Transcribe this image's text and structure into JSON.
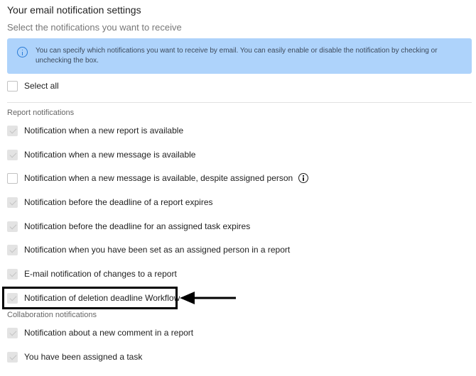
{
  "header": {
    "title": "Your email notification settings",
    "subtitle": "Select the notifications you want to receive"
  },
  "info": {
    "icon": "info-icon",
    "text": "You can specify which notifications you want to receive by email. You can easily enable or disable the notification by checking or unchecking the box."
  },
  "select_all": {
    "label": "Select all",
    "checked": false
  },
  "report_section": {
    "title": "Report notifications",
    "items": [
      {
        "label": "Notification when a new report is available",
        "checked": true
      },
      {
        "label": "Notification when a new message is available",
        "checked": true
      },
      {
        "label": "Notification when a new message is available, despite assigned person",
        "checked": false,
        "icon": "info-icon"
      },
      {
        "label": "Notification before the deadline of a report expires",
        "checked": true
      },
      {
        "label": "Notification before the deadline for an assigned task expires",
        "checked": true
      },
      {
        "label": "Notification when you have been set as an assigned person in a report",
        "checked": true
      },
      {
        "label": "E-mail notification of changes to a report",
        "checked": true
      },
      {
        "label": "Notification of deletion deadline Workflow",
        "checked": true
      }
    ]
  },
  "collaboration_section": {
    "title": "Collaboration notifications",
    "items": [
      {
        "label": "Notification about a new comment in a report",
        "checked": true
      },
      {
        "label": "You have been assigned a task",
        "checked": true
      }
    ]
  },
  "annotation": {
    "highlight": "box",
    "pointer": "arrow-left-icon"
  }
}
